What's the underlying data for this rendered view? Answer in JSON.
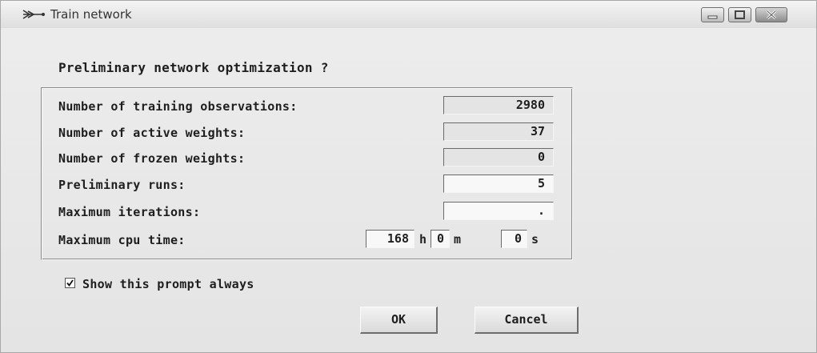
{
  "window": {
    "title": "Train network",
    "icons": {
      "app": "network-icon",
      "minimize": "minimize-icon",
      "maximize": "maximize-icon",
      "close": "close-icon"
    }
  },
  "dialog": {
    "heading": "Preliminary network optimization ?",
    "fields": {
      "training_observations": {
        "label": "Number of training observations:",
        "value": "2980"
      },
      "active_weights": {
        "label": "Number of active weights:",
        "value": "37"
      },
      "frozen_weights": {
        "label": "Number of frozen weights:",
        "value": "0"
      },
      "preliminary_runs": {
        "label": "Preliminary runs:",
        "value": "5"
      },
      "max_iterations": {
        "label": "Maximum iterations:",
        "value": "."
      }
    },
    "cpu_time": {
      "label": "Maximum cpu time:",
      "hours": "168",
      "hours_unit": "h",
      "minutes": "0",
      "minutes_unit": "m",
      "seconds": "0",
      "seconds_unit": "s"
    },
    "show_prompt": {
      "label": "Show this prompt always",
      "checked": true
    },
    "buttons": {
      "ok": "OK",
      "cancel": "Cancel"
    }
  }
}
